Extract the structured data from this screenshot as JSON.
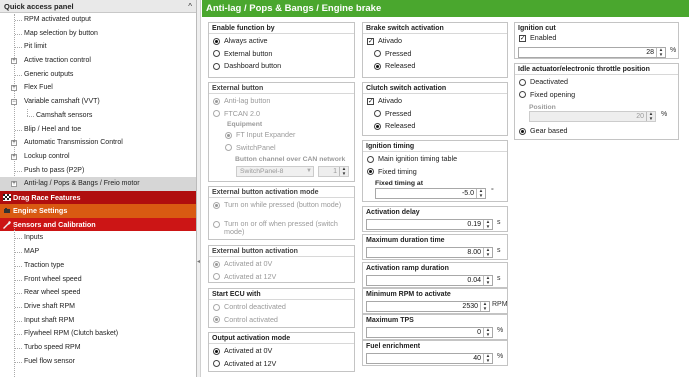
{
  "left_panel": {
    "title": "Quick access panel",
    "tree_items": [
      {
        "label": "RPM activated output"
      },
      {
        "label": "Map selection by button"
      },
      {
        "label": "Pit limit"
      },
      {
        "label": "Active traction control"
      },
      {
        "label": "Generic outputs"
      },
      {
        "label": "Flex Fuel"
      },
      {
        "label": "Variable camshaft (VVT)"
      },
      {
        "label": "Camshaft sensors"
      },
      {
        "label": "Blip / Heel and toe"
      },
      {
        "label": "Automatic Transmission Control"
      },
      {
        "label": "Lockup control"
      },
      {
        "label": "Push to pass (P2P)"
      },
      {
        "label": "Anti-lag / Pops & Bangs / Freio motor"
      }
    ],
    "sections": [
      {
        "label": "Drag Race Features"
      },
      {
        "label": "Engine Settings"
      },
      {
        "label": "Sensors and Calibration"
      }
    ],
    "sensor_items": [
      {
        "label": "Inputs"
      },
      {
        "label": "MAP"
      },
      {
        "label": "Traction type"
      },
      {
        "label": "Front wheel speed"
      },
      {
        "label": "Rear wheel speed"
      },
      {
        "label": "Drive shaft RPM"
      },
      {
        "label": "Input shaft RPM"
      },
      {
        "label": "Flywheel RPM (Clutch basket)"
      },
      {
        "label": "Turbo speed RPM"
      },
      {
        "label": "Fuel flow sensor"
      }
    ]
  },
  "header": {
    "title": "Anti-lag / Pops & Bangs / Engine brake"
  },
  "enable_function": {
    "title": "Enable function by",
    "options": [
      "Always active",
      "External button",
      "Dashboard button"
    ]
  },
  "external_button": {
    "title": "External button",
    "options": [
      "Anti-lag button",
      "FTCAN 2.0"
    ],
    "equipment_label": "Equipment",
    "equipment_options": [
      "FT Input Expander",
      "SwitchPanel"
    ],
    "channel_label": "Button channel over CAN network",
    "channel_combo": "SwitchPanel-8",
    "channel_value": "1"
  },
  "activation_mode": {
    "title": "External button activation mode",
    "options": [
      "Turn on while pressed (button mode)",
      "Turn on or off when pressed (switch mode)"
    ]
  },
  "button_activation": {
    "title": "External button activation",
    "options": [
      "Activated at 0V",
      "Activated at 12V"
    ]
  },
  "start_ecu": {
    "title": "Start ECU with",
    "options": [
      "Control deactivated",
      "Control activated"
    ]
  },
  "output_mode": {
    "title": "Output activation mode",
    "options": [
      "Activated at 0V",
      "Activated at 12V"
    ]
  },
  "brake_switch": {
    "title": "Brake switch activation",
    "check_label": "Ativado",
    "options": [
      "Pressed",
      "Released"
    ]
  },
  "clutch_switch": {
    "title": "Clutch switch activation",
    "check_label": "Ativado",
    "options": [
      "Pressed",
      "Released"
    ]
  },
  "ignition_timing": {
    "title": "Ignition timing",
    "options": [
      "Main ignition timing table",
      "Fixed timing"
    ],
    "fixed_label": "Fixed timing at",
    "fixed_value": "-5.0",
    "fixed_unit": "°"
  },
  "fields": {
    "activation_delay": {
      "label": "Activation delay",
      "value": "0.19",
      "unit": "s"
    },
    "max_duration": {
      "label": "Maximum duration time",
      "value": "8.00",
      "unit": "s"
    },
    "ramp_duration": {
      "label": "Activation ramp duration",
      "value": "0.04",
      "unit": "s"
    },
    "min_rpm": {
      "label": "Minimum RPM to activate",
      "value": "2530",
      "unit": "RPM"
    },
    "max_tps": {
      "label": "Maximum TPS",
      "value": "0",
      "unit": "%"
    },
    "fuel_enrichment": {
      "label": "Fuel enrichment",
      "value": "40",
      "unit": "%"
    }
  },
  "ignition_cut": {
    "title": "Ignition cut",
    "check_label": "Enabled",
    "value": "28",
    "unit": "%"
  },
  "idle_actuator": {
    "title": "Idle actuator/electronic throttle position",
    "options": [
      "Deactivated",
      "Fixed opening",
      "Gear based"
    ],
    "position_label": "Position",
    "position_value": "20",
    "position_unit": "%"
  },
  "colors": {
    "header_green": "#4aa72e",
    "section_dark_red": "#b00e0e",
    "section_orange": "#d95a12",
    "section_red": "#cc1515"
  }
}
